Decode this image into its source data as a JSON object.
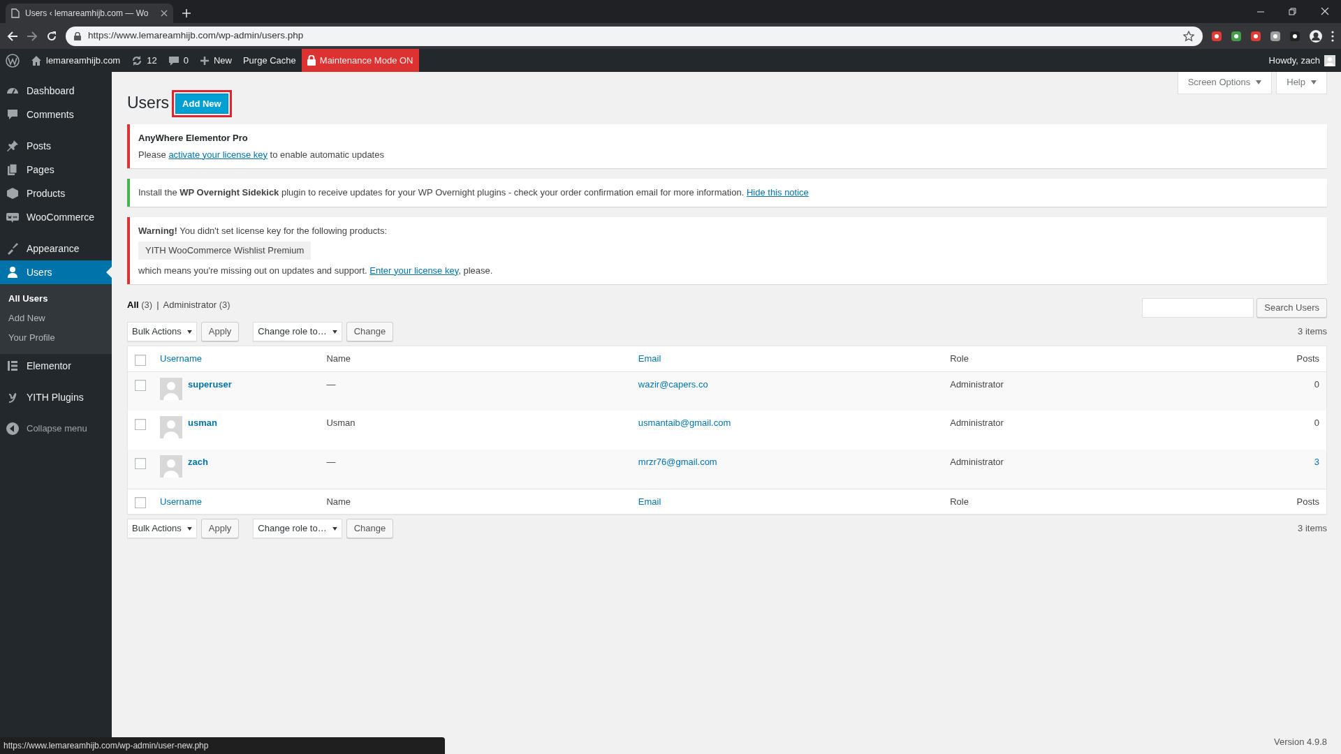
{
  "browser": {
    "tab_title": "Users ‹ lemareamhijb.com — Wo",
    "url": "https://www.lemareamhijb.com/wp-admin/users.php",
    "status_url": "https://www.lemareamhijb.com/wp-admin/user-new.php"
  },
  "admin_bar": {
    "site": "lemareamhijb.com",
    "updates": "12",
    "comments": "0",
    "new": "New",
    "purge": "Purge Cache",
    "maintenance": "Maintenance Mode ON",
    "howdy": "Howdy, zach"
  },
  "sidebar": {
    "groups": [
      {
        "items": [
          {
            "label": "Dashboard",
            "selected": false
          },
          {
            "label": "Comments",
            "selected": false
          }
        ]
      },
      {
        "items": [
          {
            "label": "Posts",
            "selected": false
          },
          {
            "label": "Pages",
            "selected": false
          },
          {
            "label": "Products",
            "selected": false
          },
          {
            "label": "WooCommerce",
            "selected": false
          }
        ]
      },
      {
        "items": [
          {
            "label": "Appearance",
            "selected": false
          },
          {
            "label": "Users",
            "selected": true,
            "children": [
              {
                "label": "All Users",
                "selected": true
              },
              {
                "label": "Add New",
                "selected": false
              },
              {
                "label": "Your Profile",
                "selected": false
              }
            ]
          },
          {
            "label": "Elementor",
            "selected": false
          }
        ]
      },
      {
        "items": [
          {
            "label": "YITH Plugins",
            "selected": false
          }
        ]
      }
    ],
    "collapse": "Collapse menu"
  },
  "header": {
    "title": "Users",
    "add_new": "Add New",
    "add_new_highlighted": true,
    "screen_options": "Screen Options",
    "help": "Help"
  },
  "notices": [
    {
      "color": "#dc3232",
      "lines": [
        {
          "parts": [
            {
              "kind": "title",
              "text": "AnyWhere Elementor Pro"
            }
          ]
        },
        {
          "parts": [
            {
              "kind": "text",
              "text": "Please "
            },
            {
              "kind": "link",
              "text": "activate your license key"
            },
            {
              "kind": "text",
              "text": " to enable automatic updates"
            }
          ]
        }
      ]
    },
    {
      "color": "#46b450",
      "lines": [
        {
          "parts": [
            {
              "kind": "text",
              "text": "Install the **WP Overnight Sidekick** plugin to receive updates for your WP Overnight plugins - check your order confirmation email for more information. "
            },
            {
              "kind": "link",
              "text": "Hide this notice"
            }
          ]
        }
      ]
    },
    {
      "color": "#dc3232",
      "lines": [
        {
          "parts": [
            {
              "kind": "text",
              "text": "**Warning!** You didn't set license key for the following products:"
            }
          ]
        },
        {
          "parts": [
            {
              "kind": "tag",
              "text": "YITH WooCommerce Wishlist Premium"
            }
          ]
        },
        {
          "parts": [
            {
              "kind": "text",
              "text": "which means you're missing out on updates and support. "
            },
            {
              "kind": "link",
              "text": "Enter your license key"
            },
            {
              "kind": "text",
              "text": ", please."
            }
          ]
        }
      ]
    }
  ],
  "filter_separator": "|",
  "filters": [
    {
      "label": "All",
      "count": "(3)",
      "selected": true
    },
    {
      "label": "Administrator",
      "count": "(3)",
      "selected": false
    }
  ],
  "search": {
    "button": "Search Users"
  },
  "toolbars": [
    {
      "bulk": "Bulk Actions",
      "apply": "Apply",
      "role": "Change role to…",
      "change": "Change",
      "count": "3 items"
    },
    {
      "bulk": "Bulk Actions",
      "apply": "Apply",
      "role": "Change role to…",
      "change": "Change",
      "count": "3 items"
    }
  ],
  "table": {
    "select_all_checked": false,
    "columns": [
      {
        "label": "Username",
        "sortable": true
      },
      {
        "label": "Name",
        "sortable": false
      },
      {
        "label": "Email",
        "sortable": true
      },
      {
        "label": "Role",
        "sortable": false
      },
      {
        "label": "Posts",
        "sortable": false
      }
    ],
    "rows": [
      {
        "checked": false,
        "username": "superuser",
        "name": "—",
        "email": "wazir@capers.co",
        "role": "Administrator",
        "posts": "0",
        "posts_link": false
      },
      {
        "checked": false,
        "username": "usman",
        "name": "Usman",
        "email": "usmantaib@gmail.com",
        "role": "Administrator",
        "posts": "0",
        "posts_link": false
      },
      {
        "checked": false,
        "username": "zach",
        "name": "—",
        "email": "mrzr76@gmail.com",
        "role": "Administrator",
        "posts": "3",
        "posts_link": true
      }
    ],
    "footer_columns": [
      {
        "label": "Username",
        "sortable": true
      },
      {
        "label": "Name",
        "sortable": false
      },
      {
        "label": "Email",
        "sortable": true
      },
      {
        "label": "Role",
        "sortable": false
      },
      {
        "label": "Posts",
        "sortable": false
      }
    ]
  },
  "footer": {
    "version": "Version 4.9.8"
  }
}
